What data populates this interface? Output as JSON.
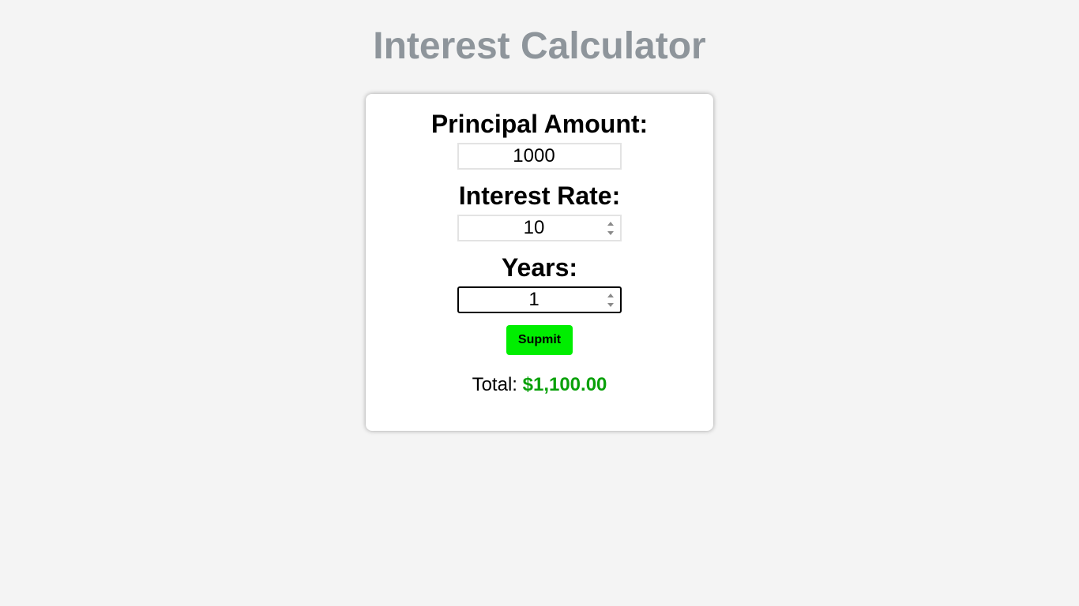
{
  "page": {
    "title": "Interest Calculator"
  },
  "form": {
    "principal": {
      "label": "Principal Amount:",
      "value": "1000"
    },
    "rate": {
      "label": "Interest Rate:",
      "value": "10"
    },
    "years": {
      "label": "Years:",
      "value": "1"
    },
    "submit_label": "Supmit"
  },
  "result": {
    "label": "Total:",
    "value": "$1,100.00"
  },
  "colors": {
    "title": "#8e959b",
    "button": "#00ee00",
    "total_value": "#0aa10a",
    "background": "#f4f4f4"
  },
  "icons": {
    "spinner_up": "chevron-up-icon",
    "spinner_down": "chevron-down-icon"
  }
}
